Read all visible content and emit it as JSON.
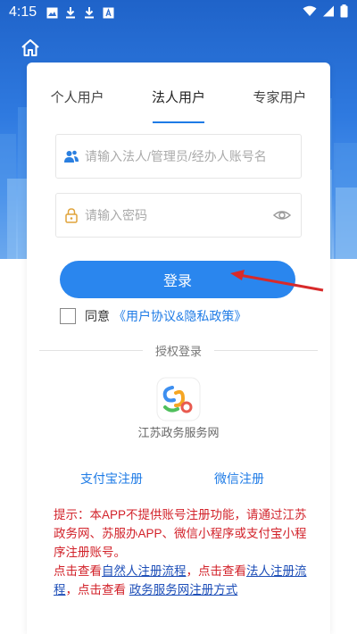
{
  "status_bar": {
    "time": "4:15"
  },
  "tabs": [
    "个人用户",
    "法人用户",
    "专家用户"
  ],
  "account": {
    "placeholder": "请输入法人/管理员/经办人账号名"
  },
  "password": {
    "placeholder": "请输入密码"
  },
  "login_label": "登录",
  "agree": {
    "prefix": "同意",
    "link": "《用户协议&隐私政策》"
  },
  "auth": {
    "divider": "授权登录",
    "provider": "江苏政务服务网"
  },
  "register": {
    "alipay": "支付宝注册",
    "wechat": "微信注册"
  },
  "notice": {
    "text1": "提示：本APP不提供账号注册功能，请通过江苏政务网、苏服办APP、微信小程序或支付宝小程序注册账号。",
    "text2": "点击查看",
    "link1": "自然人注册流程",
    "text3": "，点击查看",
    "link2": "法人注册流程",
    "text4": "，点击查看 ",
    "link3": "政务服务网注册方式"
  },
  "colors": {
    "accent": "#2a86ee",
    "notice_red": "#d2222a",
    "link_blue": "#1e7be6"
  },
  "icons": [
    "home-icon",
    "user-group-icon",
    "lock-icon",
    "eye-icon",
    "checkbox",
    "suzhou-logo-icon"
  ]
}
